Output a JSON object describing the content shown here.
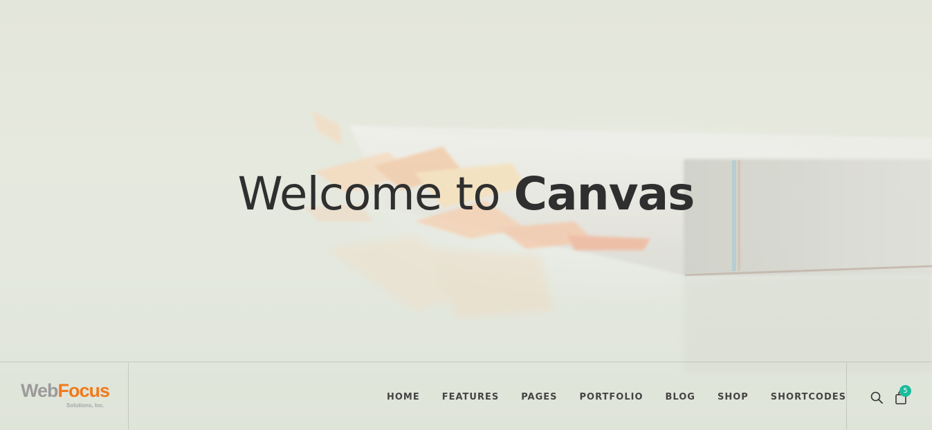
{
  "hero": {
    "title_light": "Welcome to ",
    "title_bold": "Canvas"
  },
  "logo": {
    "part1": "Web",
    "part2": "Focus",
    "subtitle": "Solutions, Inc."
  },
  "nav": {
    "items": [
      {
        "label": "HOME"
      },
      {
        "label": "FEATURES"
      },
      {
        "label": "PAGES"
      },
      {
        "label": "PORTFOLIO"
      },
      {
        "label": "BLOG"
      },
      {
        "label": "SHOP"
      },
      {
        "label": "SHORTCODES"
      }
    ]
  },
  "tools": {
    "search_icon": "search-icon",
    "cart_icon": "shopping-bag-icon",
    "cart_count": "5"
  },
  "colors": {
    "accent": "#1abc9c",
    "logo_gray": "#9b9b9b",
    "logo_orange": "#f07a1c",
    "text_dark": "#2f2f2f"
  }
}
